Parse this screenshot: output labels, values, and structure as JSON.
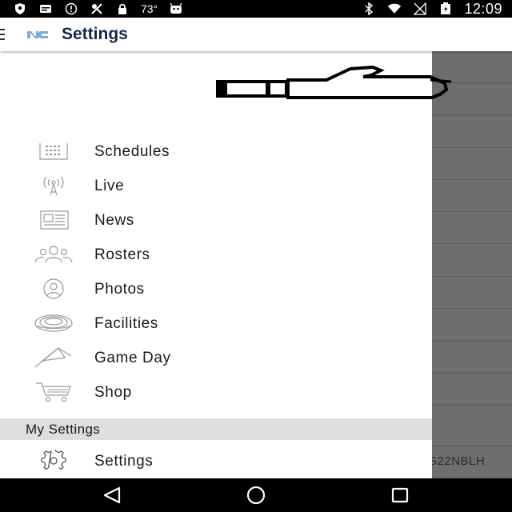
{
  "status_bar": {
    "temperature": "73°",
    "time": "12:09",
    "left_icons": [
      "shield-icon",
      "message-icon",
      "alert-circle-icon",
      "no-location-icon",
      "lock-icon",
      "temperature-label",
      "android-icon"
    ],
    "right_icons": [
      "bluetooth-icon",
      "wifi-icon",
      "no-signal-icon",
      "battery-icon",
      "time-label"
    ]
  },
  "header": {
    "title": "Settings",
    "logo_icon": "nc-logo-icon",
    "accent_color": "#13294b",
    "logo_color": "#7bafd4"
  },
  "drawer": {
    "hero_icon": "drawn-thumbs-up-graphic",
    "items": [
      {
        "label": "Schedules",
        "icon": "calendar-icon"
      },
      {
        "label": "Live",
        "icon": "broadcast-icon"
      },
      {
        "label": "News",
        "icon": "newspaper-icon"
      },
      {
        "label": "Rosters",
        "icon": "team-icon"
      },
      {
        "label": "Photos",
        "icon": "photo-person-icon"
      },
      {
        "label": "Facilities",
        "icon": "stadium-icon"
      },
      {
        "label": "Game Day",
        "icon": "pennant-icon"
      },
      {
        "label": "Shop",
        "icon": "cart-icon"
      }
    ],
    "section_header": "My Settings",
    "settings_item": {
      "label": "Settings",
      "icon": "gear-icon"
    }
  },
  "background_content": {
    "code_text": "S22NBLH"
  },
  "nav_bar": {
    "back_icon": "back-triangle-icon",
    "home_icon": "home-circle-icon",
    "recents_icon": "recents-square-icon"
  }
}
